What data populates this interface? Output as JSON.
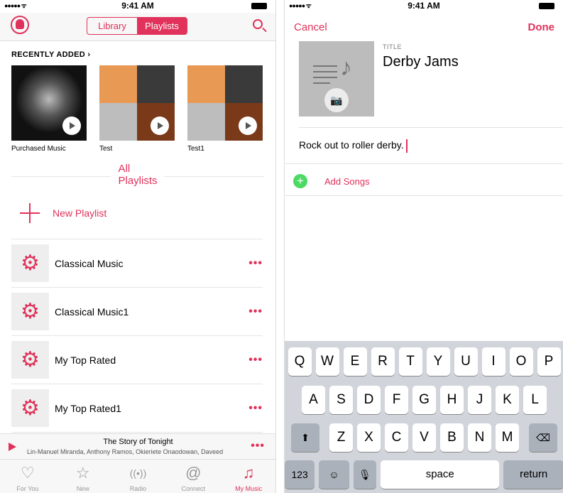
{
  "status": {
    "time": "9:41 AM"
  },
  "left": {
    "segments": [
      "Library",
      "Playlists"
    ],
    "recently_added": "RECENTLY ADDED",
    "albums": [
      {
        "title": "Purchased Music"
      },
      {
        "title": "Test"
      },
      {
        "title": "Test1"
      }
    ],
    "all_playlists": "All Playlists",
    "new_playlist": "New Playlist",
    "playlists": [
      "Classical Music",
      "Classical Music1",
      "My Top Rated",
      "My Top Rated1"
    ],
    "now_playing": {
      "title": "The Story of Tonight",
      "artist": "Lin-Manuel Miranda, Anthony Ramos, Okieriete Onaodowan, Daveed"
    },
    "tabs": [
      {
        "label": "For You",
        "icon": "heart-icon"
      },
      {
        "label": "New",
        "icon": "star-icon"
      },
      {
        "label": "Radio",
        "icon": "radio-icon"
      },
      {
        "label": "Connect",
        "icon": "at-icon"
      },
      {
        "label": "My Music",
        "icon": "music-note-icon"
      }
    ]
  },
  "right": {
    "cancel": "Cancel",
    "done": "Done",
    "title_label": "TITLE",
    "title_value": "Derby Jams",
    "description": "Rock out to roller derby.",
    "add_songs": "Add Songs",
    "keyboard": {
      "row1": [
        "Q",
        "W",
        "E",
        "R",
        "T",
        "Y",
        "U",
        "I",
        "O",
        "P"
      ],
      "row2": [
        "A",
        "S",
        "D",
        "F",
        "G",
        "H",
        "J",
        "K",
        "L"
      ],
      "row3": [
        "Z",
        "X",
        "C",
        "V",
        "B",
        "N",
        "M"
      ],
      "numbers": "123",
      "space": "space",
      "return": "return"
    }
  },
  "colors": {
    "accent": "#e0325a",
    "add": "#4cd964"
  }
}
